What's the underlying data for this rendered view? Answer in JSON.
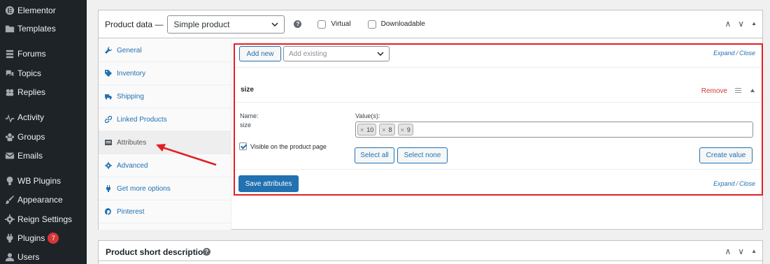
{
  "sidebar": {
    "items": [
      {
        "label": "Elementor",
        "icon": "elementor-icon",
        "badge": ""
      },
      {
        "label": "Templates",
        "icon": "folder-icon",
        "badge": ""
      },
      {
        "label": "Forums",
        "icon": "forums-icon",
        "badge": ""
      },
      {
        "label": "Topics",
        "icon": "topics-icon",
        "badge": ""
      },
      {
        "label": "Replies",
        "icon": "replies-icon",
        "badge": ""
      },
      {
        "label": "Activity",
        "icon": "activity-icon",
        "badge": ""
      },
      {
        "label": "Groups",
        "icon": "groups-icon",
        "badge": ""
      },
      {
        "label": "Emails",
        "icon": "email-icon",
        "badge": ""
      },
      {
        "label": "WB Plugins",
        "icon": "bulb-icon",
        "badge": ""
      },
      {
        "label": "Appearance",
        "icon": "paintbrush-icon",
        "badge": ""
      },
      {
        "label": "Reign Settings",
        "icon": "gear-icon",
        "badge": ""
      },
      {
        "label": "Plugins",
        "icon": "plugin-icon",
        "badge": "7"
      },
      {
        "label": "Users",
        "icon": "users-icon",
        "badge": ""
      }
    ]
  },
  "product_data": {
    "title": "Product data —",
    "type_value": "Simple product",
    "help_glyph": "?",
    "virtual_label": "Virtual",
    "downloadable_label": "Downloadable",
    "header_glyphs": {
      "up": "∧",
      "down": "∨",
      "toggle": "▲"
    },
    "tabs": [
      {
        "label": "General",
        "icon": "wrench-icon",
        "active": false
      },
      {
        "label": "Inventory",
        "icon": "tag-icon",
        "active": false
      },
      {
        "label": "Shipping",
        "icon": "truck-icon",
        "active": false
      },
      {
        "label": "Linked Products",
        "icon": "link-icon",
        "active": false
      },
      {
        "label": "Attributes",
        "icon": "list-icon",
        "active": true
      },
      {
        "label": "Advanced",
        "icon": "gear-icon",
        "active": false
      },
      {
        "label": "Get more options",
        "icon": "plugin-icon",
        "active": false
      },
      {
        "label": "Pinterest",
        "icon": "pinterest-icon",
        "active": false
      }
    ]
  },
  "attributes": {
    "add_new_label": "Add new",
    "add_existing_placeholder": "Add existing",
    "expand_label": "Expand",
    "separator": "/",
    "close_label": "Close",
    "attribute_name": "size",
    "remove_label": "Remove",
    "name_label": "Name:",
    "name_value": "size",
    "values_label": "Value(s):",
    "chip_remove_glyph": "×",
    "values": [
      "10",
      "8",
      "9"
    ],
    "visible_label": "Visible on the product page",
    "visible_checked": true,
    "select_all_label": "Select all",
    "select_none_label": "Select none",
    "create_value_label": "Create value",
    "save_label": "Save attributes"
  },
  "short_description": {
    "title": "Product short description",
    "help_glyph": "?"
  },
  "colors": {
    "accent": "#2271b1",
    "danger": "#d63638",
    "annotation": "#e21f25",
    "sidebar_bg": "#1d2327"
  }
}
